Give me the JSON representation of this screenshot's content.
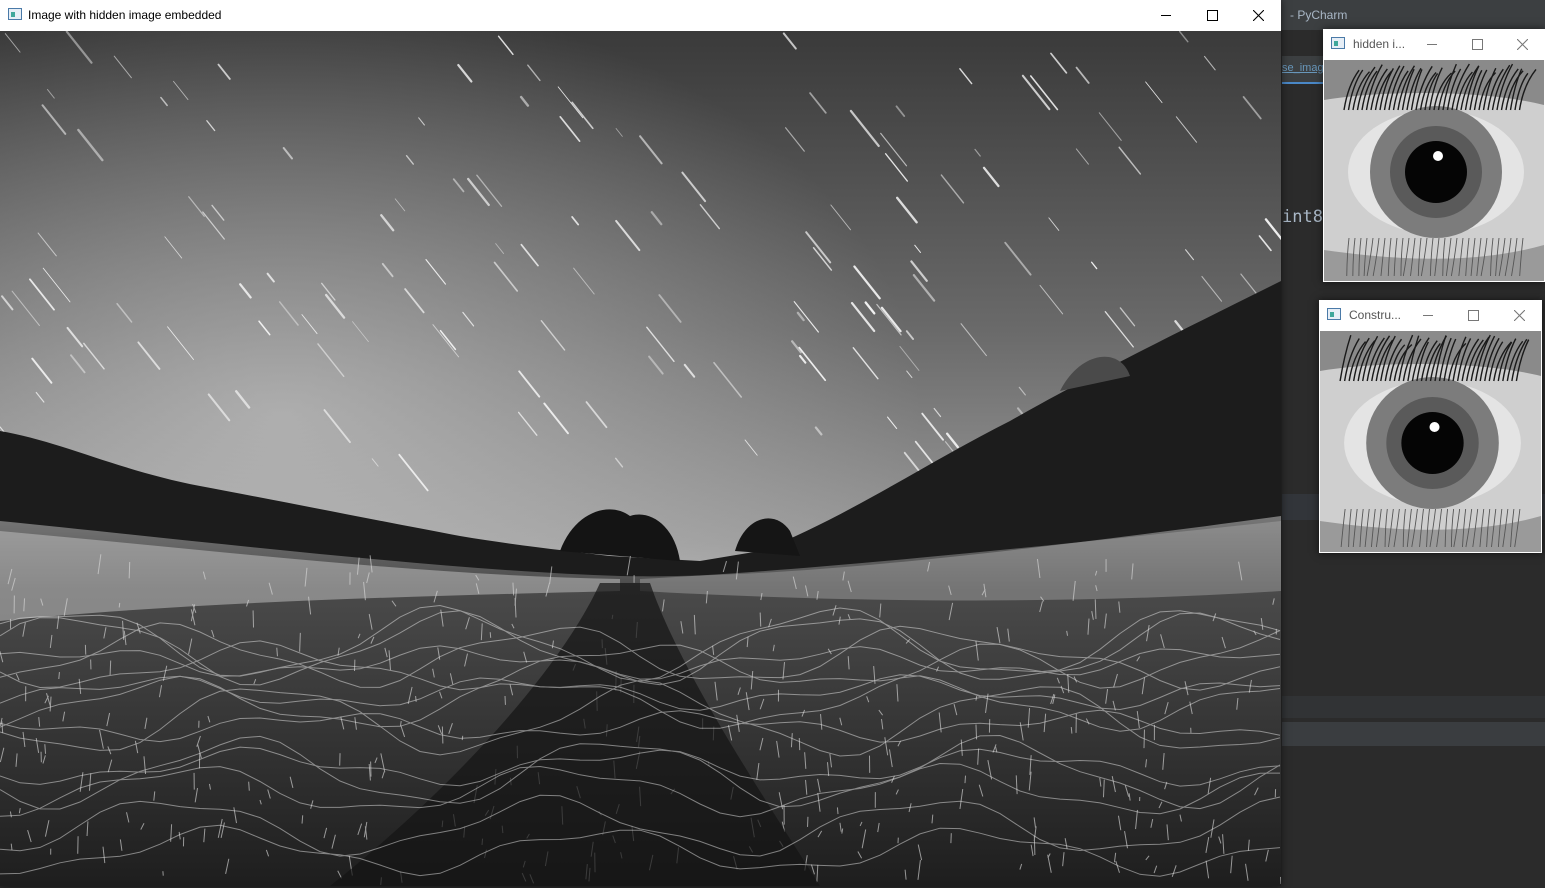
{
  "ide": {
    "window_title": "- PyCharm",
    "editor_tab": "se_imag",
    "code_fragment": "int8"
  },
  "main_window": {
    "title": "Image with hidden image embedded",
    "image_icon": "landscape-image"
  },
  "hidden_window": {
    "title": "hidden i...",
    "image_icon": "eye-image"
  },
  "constructed_window": {
    "title": "Constru...",
    "image_icon": "eye-image"
  },
  "window_controls": {
    "minimize_icon": "minimize-icon",
    "maximize_icon": "maximize-icon",
    "close_icon": "close-icon"
  }
}
